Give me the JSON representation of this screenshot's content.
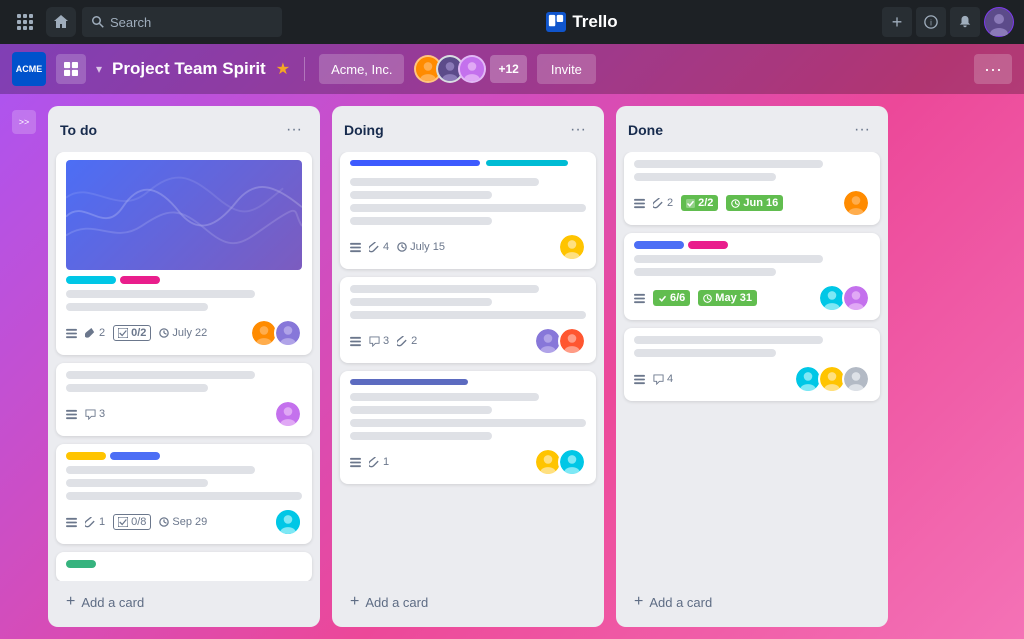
{
  "nav": {
    "search_placeholder": "Search",
    "brand_name": "Trello",
    "add_label": "+",
    "info_label": "ℹ",
    "bell_label": "🔔"
  },
  "board_header": {
    "logo_text": "ACME",
    "title": "Project Team Spirit",
    "workspace": "Acme, Inc.",
    "member_extra": "+12",
    "invite_label": "Invite",
    "more_label": "···"
  },
  "lists": [
    {
      "id": "todo",
      "title": "To do",
      "menu_label": "···",
      "cards": [
        {
          "id": "c1",
          "has_image": true,
          "labels": [
            "cyan",
            "pink"
          ],
          "text_lines": [
            "medium",
            "short",
            "full"
          ],
          "meta": {
            "list": true,
            "attachments": 2,
            "checklist": "0/2",
            "date": "July 22"
          },
          "avatars": [
            "orange",
            "purple"
          ]
        },
        {
          "id": "c2",
          "has_image": false,
          "labels": [],
          "text_lines": [
            "medium",
            "short"
          ],
          "meta": {
            "list": true,
            "comments": 3
          },
          "avatars": [
            "purple"
          ]
        },
        {
          "id": "c3",
          "has_image": false,
          "labels": [
            "yellow",
            "blue-dark"
          ],
          "text_lines": [
            "medium",
            "short",
            "full"
          ],
          "meta": {
            "list": true,
            "attachments": 1,
            "checklist": "0/8",
            "date": "Sep 29"
          },
          "avatars": [
            "teal"
          ]
        },
        {
          "id": "c4",
          "has_image": false,
          "labels": [
            "green"
          ],
          "text_lines": [],
          "meta": {},
          "avatars": []
        }
      ],
      "add_label": "+ Add a card"
    },
    {
      "id": "doing",
      "title": "Doing",
      "menu_label": "···",
      "cards": [
        {
          "id": "c5",
          "has_image": false,
          "has_bars": true,
          "bars": [
            "dark-blue",
            "cyan"
          ],
          "text_lines": [
            "medium",
            "short",
            "full",
            "short"
          ],
          "meta": {
            "list": true,
            "attachments": 4,
            "date": "July 15"
          },
          "avatars": [
            "yellow"
          ]
        },
        {
          "id": "c6",
          "has_image": false,
          "labels": [],
          "text_lines": [
            "medium",
            "short",
            "full"
          ],
          "meta": {
            "list": true,
            "comments": 3,
            "attachments": 2
          },
          "avatars": [
            "purple",
            "red"
          ]
        },
        {
          "id": "c7",
          "has_image": false,
          "has_bar": true,
          "bar": "blue2",
          "text_lines": [
            "medium",
            "short",
            "full",
            "short"
          ],
          "meta": {
            "list": true,
            "attachments": 1
          },
          "avatars": [
            "yellow",
            "teal"
          ]
        }
      ],
      "add_label": "+ Add a card"
    },
    {
      "id": "done",
      "title": "Done",
      "menu_label": "···",
      "cards": [
        {
          "id": "c8",
          "has_image": false,
          "labels": [],
          "text_lines": [
            "medium",
            "short"
          ],
          "meta": {
            "list": true,
            "attachments": 2,
            "checklist_done": "2/2",
            "date_done": "Jun 16"
          },
          "avatars": [
            "orange"
          ]
        },
        {
          "id": "c9",
          "has_image": false,
          "labels": [
            "blue-dark",
            "pink"
          ],
          "text_lines": [
            "medium",
            "short"
          ],
          "meta": {
            "list": true,
            "checklist_done": "6/6",
            "date_done": "May 31"
          },
          "avatars": [
            "teal",
            "purple"
          ]
        },
        {
          "id": "c10",
          "has_image": false,
          "labels": [],
          "text_lines": [
            "medium",
            "short"
          ],
          "meta": {
            "list": true,
            "comments": 4
          },
          "avatars": [
            "teal",
            "yellow",
            "gray"
          ]
        }
      ],
      "add_label": "+ Add a card"
    }
  ],
  "sidebar": {
    "collapse_label": ">>"
  }
}
